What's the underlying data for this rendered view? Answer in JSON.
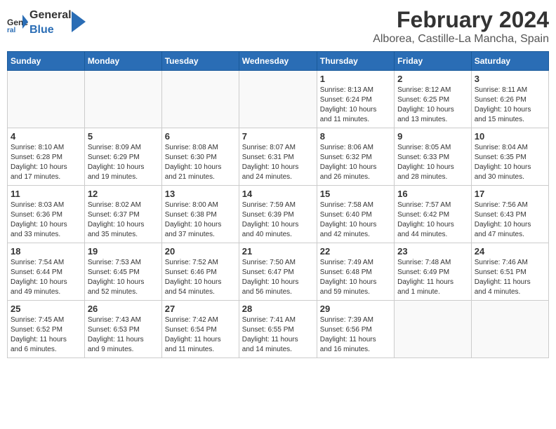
{
  "header": {
    "logo_general": "General",
    "logo_blue": "Blue",
    "month_year": "February 2024",
    "location": "Alborea, Castille-La Mancha, Spain"
  },
  "days_of_week": [
    "Sunday",
    "Monday",
    "Tuesday",
    "Wednesday",
    "Thursday",
    "Friday",
    "Saturday"
  ],
  "weeks": [
    [
      {
        "day": "",
        "info": ""
      },
      {
        "day": "",
        "info": ""
      },
      {
        "day": "",
        "info": ""
      },
      {
        "day": "",
        "info": ""
      },
      {
        "day": "1",
        "info": "Sunrise: 8:13 AM\nSunset: 6:24 PM\nDaylight: 10 hours\nand 11 minutes."
      },
      {
        "day": "2",
        "info": "Sunrise: 8:12 AM\nSunset: 6:25 PM\nDaylight: 10 hours\nand 13 minutes."
      },
      {
        "day": "3",
        "info": "Sunrise: 8:11 AM\nSunset: 6:26 PM\nDaylight: 10 hours\nand 15 minutes."
      }
    ],
    [
      {
        "day": "4",
        "info": "Sunrise: 8:10 AM\nSunset: 6:28 PM\nDaylight: 10 hours\nand 17 minutes."
      },
      {
        "day": "5",
        "info": "Sunrise: 8:09 AM\nSunset: 6:29 PM\nDaylight: 10 hours\nand 19 minutes."
      },
      {
        "day": "6",
        "info": "Sunrise: 8:08 AM\nSunset: 6:30 PM\nDaylight: 10 hours\nand 21 minutes."
      },
      {
        "day": "7",
        "info": "Sunrise: 8:07 AM\nSunset: 6:31 PM\nDaylight: 10 hours\nand 24 minutes."
      },
      {
        "day": "8",
        "info": "Sunrise: 8:06 AM\nSunset: 6:32 PM\nDaylight: 10 hours\nand 26 minutes."
      },
      {
        "day": "9",
        "info": "Sunrise: 8:05 AM\nSunset: 6:33 PM\nDaylight: 10 hours\nand 28 minutes."
      },
      {
        "day": "10",
        "info": "Sunrise: 8:04 AM\nSunset: 6:35 PM\nDaylight: 10 hours\nand 30 minutes."
      }
    ],
    [
      {
        "day": "11",
        "info": "Sunrise: 8:03 AM\nSunset: 6:36 PM\nDaylight: 10 hours\nand 33 minutes."
      },
      {
        "day": "12",
        "info": "Sunrise: 8:02 AM\nSunset: 6:37 PM\nDaylight: 10 hours\nand 35 minutes."
      },
      {
        "day": "13",
        "info": "Sunrise: 8:00 AM\nSunset: 6:38 PM\nDaylight: 10 hours\nand 37 minutes."
      },
      {
        "day": "14",
        "info": "Sunrise: 7:59 AM\nSunset: 6:39 PM\nDaylight: 10 hours\nand 40 minutes."
      },
      {
        "day": "15",
        "info": "Sunrise: 7:58 AM\nSunset: 6:40 PM\nDaylight: 10 hours\nand 42 minutes."
      },
      {
        "day": "16",
        "info": "Sunrise: 7:57 AM\nSunset: 6:42 PM\nDaylight: 10 hours\nand 44 minutes."
      },
      {
        "day": "17",
        "info": "Sunrise: 7:56 AM\nSunset: 6:43 PM\nDaylight: 10 hours\nand 47 minutes."
      }
    ],
    [
      {
        "day": "18",
        "info": "Sunrise: 7:54 AM\nSunset: 6:44 PM\nDaylight: 10 hours\nand 49 minutes."
      },
      {
        "day": "19",
        "info": "Sunrise: 7:53 AM\nSunset: 6:45 PM\nDaylight: 10 hours\nand 52 minutes."
      },
      {
        "day": "20",
        "info": "Sunrise: 7:52 AM\nSunset: 6:46 PM\nDaylight: 10 hours\nand 54 minutes."
      },
      {
        "day": "21",
        "info": "Sunrise: 7:50 AM\nSunset: 6:47 PM\nDaylight: 10 hours\nand 56 minutes."
      },
      {
        "day": "22",
        "info": "Sunrise: 7:49 AM\nSunset: 6:48 PM\nDaylight: 10 hours\nand 59 minutes."
      },
      {
        "day": "23",
        "info": "Sunrise: 7:48 AM\nSunset: 6:49 PM\nDaylight: 11 hours\nand 1 minute."
      },
      {
        "day": "24",
        "info": "Sunrise: 7:46 AM\nSunset: 6:51 PM\nDaylight: 11 hours\nand 4 minutes."
      }
    ],
    [
      {
        "day": "25",
        "info": "Sunrise: 7:45 AM\nSunset: 6:52 PM\nDaylight: 11 hours\nand 6 minutes."
      },
      {
        "day": "26",
        "info": "Sunrise: 7:43 AM\nSunset: 6:53 PM\nDaylight: 11 hours\nand 9 minutes."
      },
      {
        "day": "27",
        "info": "Sunrise: 7:42 AM\nSunset: 6:54 PM\nDaylight: 11 hours\nand 11 minutes."
      },
      {
        "day": "28",
        "info": "Sunrise: 7:41 AM\nSunset: 6:55 PM\nDaylight: 11 hours\nand 14 minutes."
      },
      {
        "day": "29",
        "info": "Sunrise: 7:39 AM\nSunset: 6:56 PM\nDaylight: 11 hours\nand 16 minutes."
      },
      {
        "day": "",
        "info": ""
      },
      {
        "day": "",
        "info": ""
      }
    ]
  ]
}
